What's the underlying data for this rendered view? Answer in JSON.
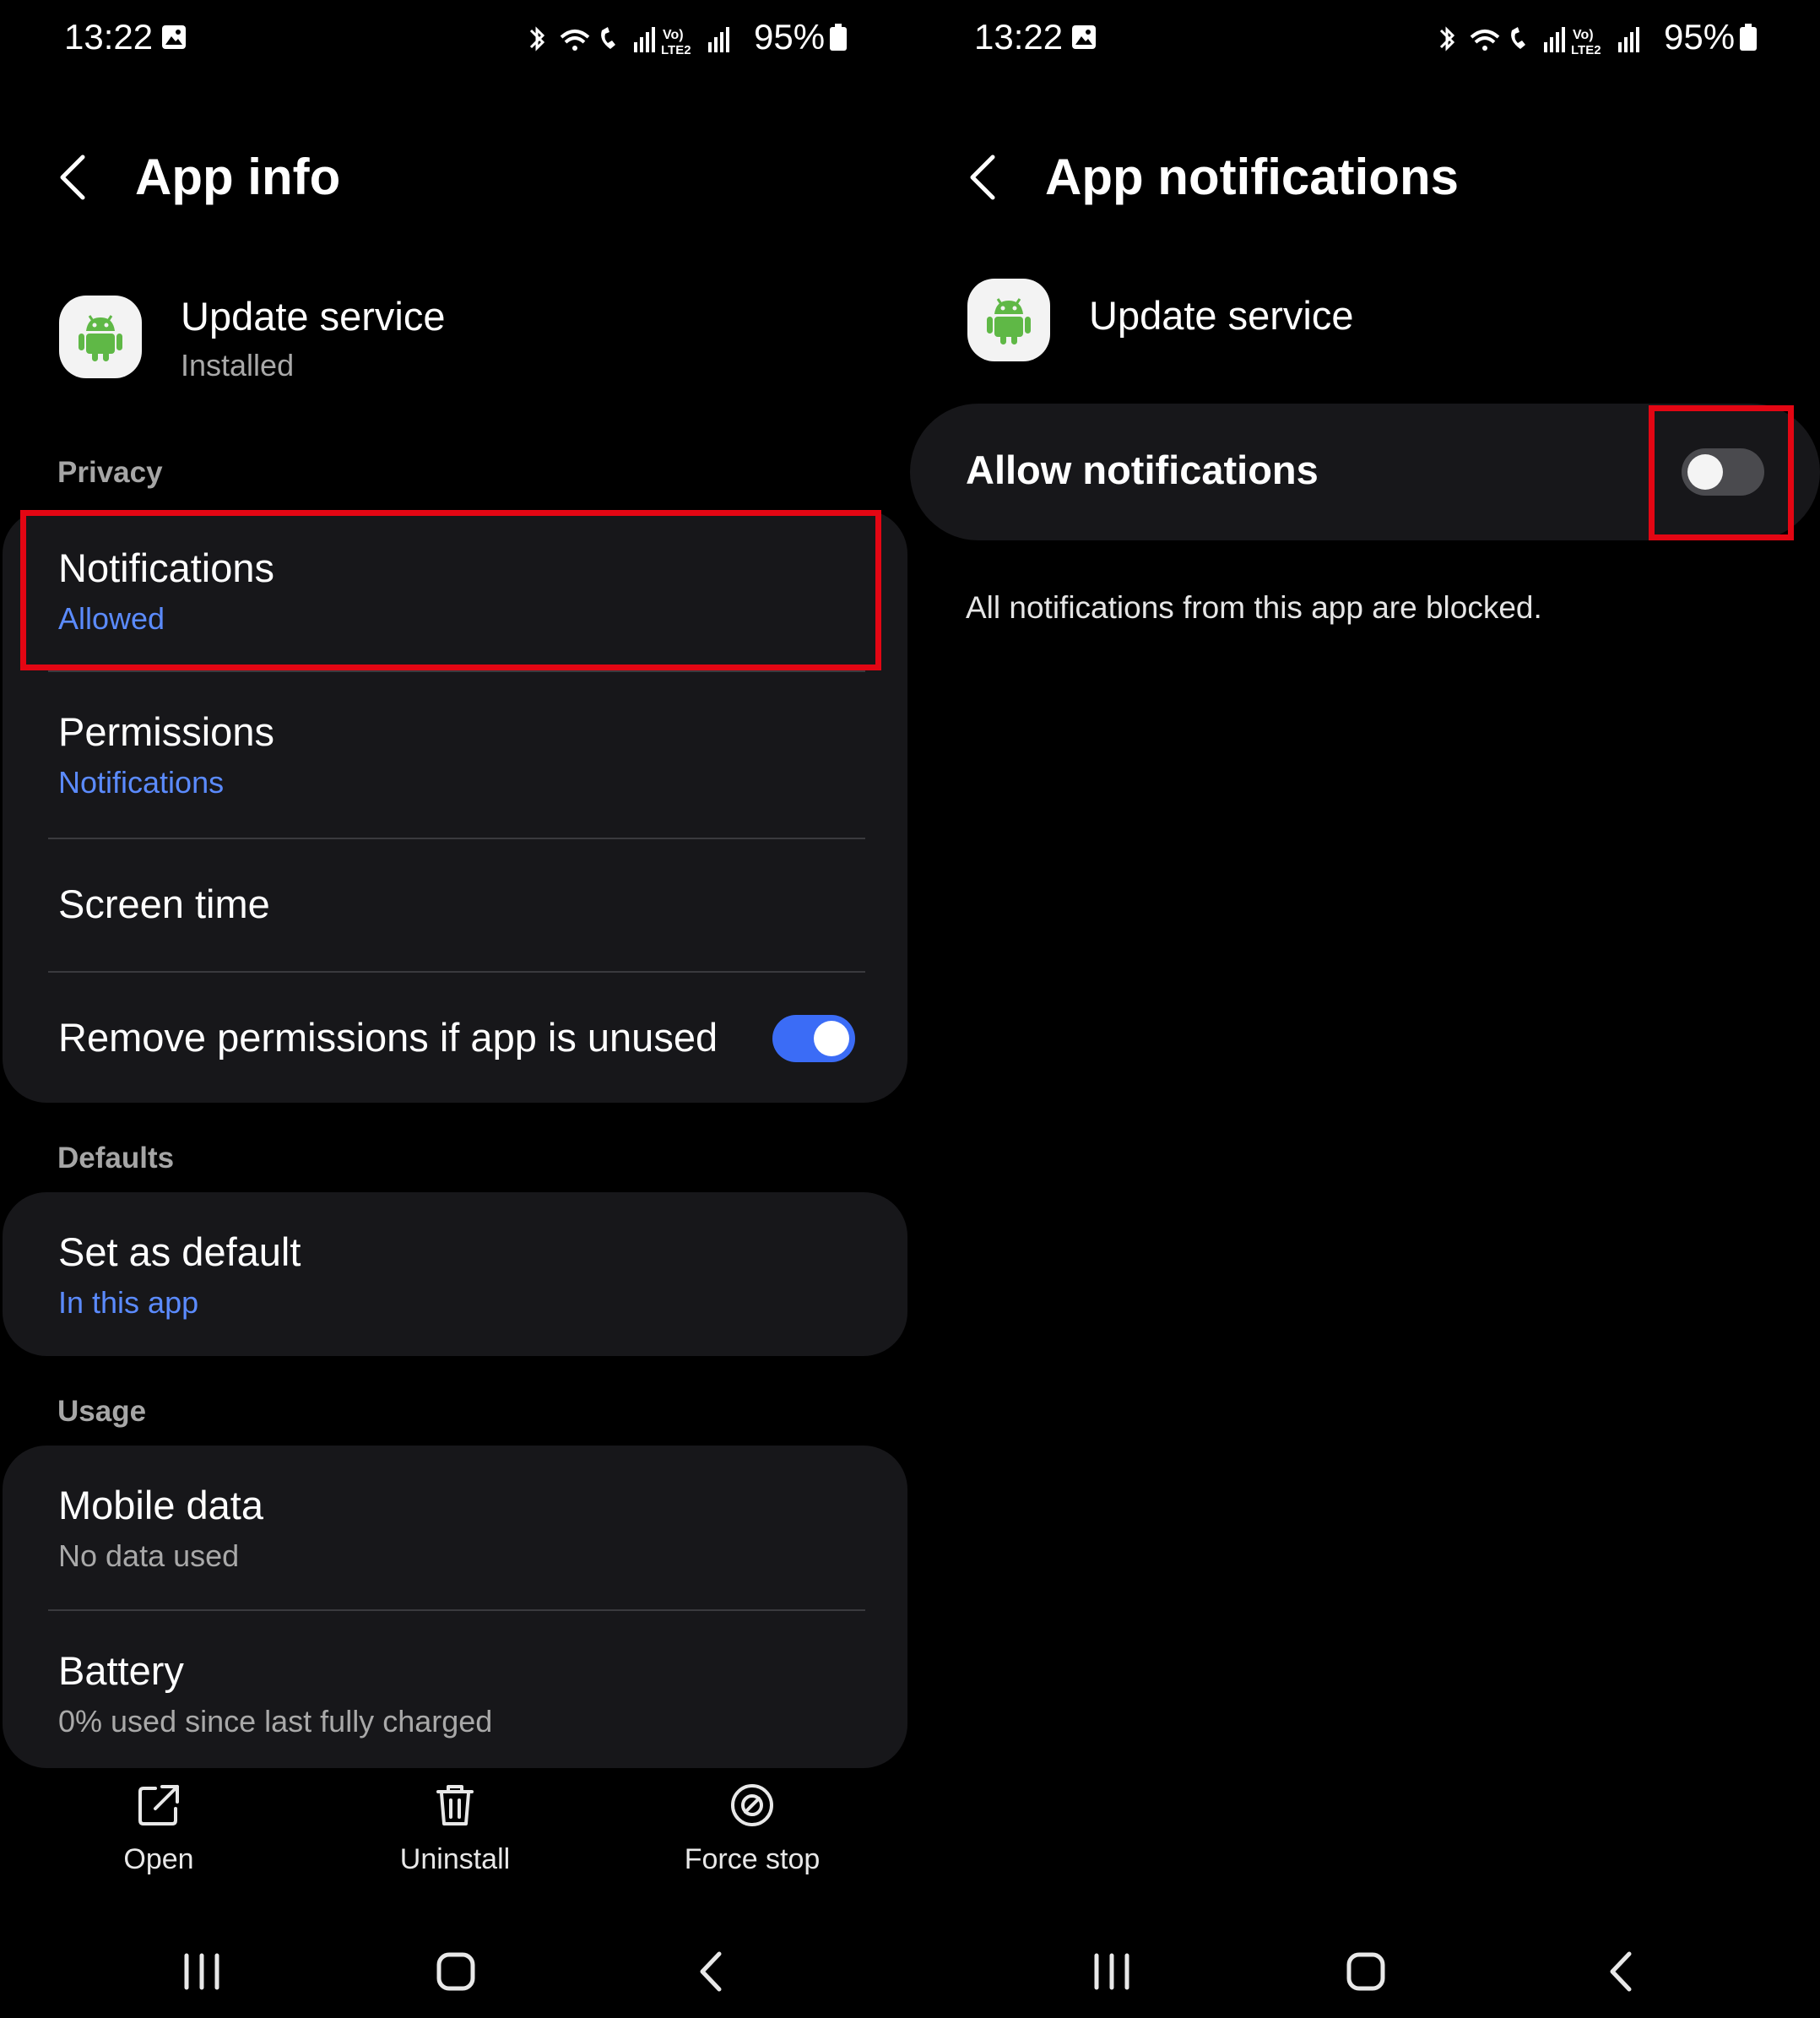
{
  "status_bar": {
    "time": "13:22",
    "battery": "95%"
  },
  "left": {
    "title": "App info",
    "app": {
      "name": "Update service",
      "status": "Installed"
    },
    "sections": {
      "privacy": "Privacy",
      "defaults": "Defaults",
      "usage": "Usage"
    },
    "privacy_items": [
      {
        "title": "Notifications",
        "sub": "Allowed"
      },
      {
        "title": "Permissions",
        "sub": "Notifications"
      },
      {
        "title": "Screen time"
      },
      {
        "title": "Remove permissions if app is unused",
        "toggle": "on"
      }
    ],
    "defaults_items": [
      {
        "title": "Set as default",
        "sub": "In this app"
      }
    ],
    "usage_items": [
      {
        "title": "Mobile data",
        "sub": "No data used"
      },
      {
        "title": "Battery",
        "sub": "0% used since last fully charged"
      }
    ],
    "actions": [
      {
        "label": "Open",
        "icon": "open-external-icon"
      },
      {
        "label": "Uninstall",
        "icon": "trash-icon"
      },
      {
        "label": "Force stop",
        "icon": "stop-icon"
      }
    ]
  },
  "right": {
    "title": "App notifications",
    "app": {
      "name": "Update service"
    },
    "allow_label": "Allow notifications",
    "allow_toggle": "off",
    "blocked_message": "All notifications from this app are blocked."
  },
  "nav_icons": [
    "recents-icon",
    "home-icon",
    "back-nav-icon"
  ],
  "colors": {
    "background": "#000000",
    "card": "#17171a",
    "accent_blue": "#5b8bff",
    "toggle_on": "#3b6cf6",
    "highlight_red": "#e30613",
    "android_green": "#5fb846"
  }
}
